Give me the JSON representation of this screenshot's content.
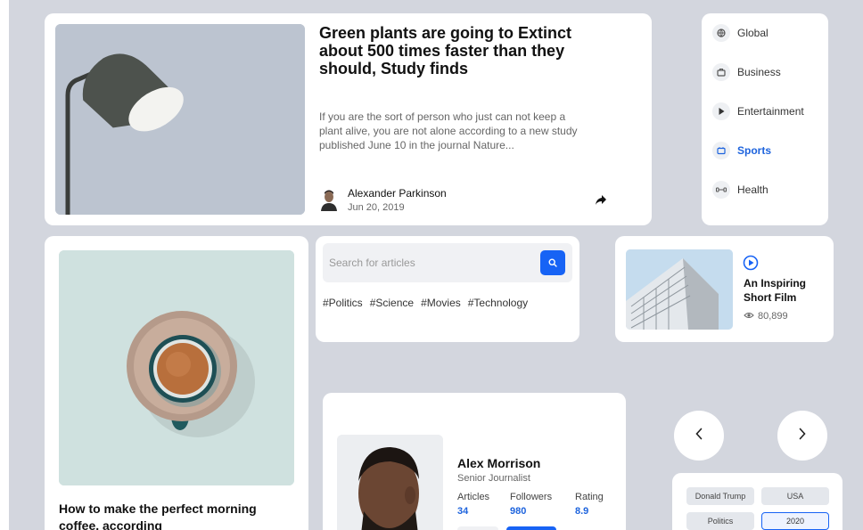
{
  "hero": {
    "title": "Green plants are going to Extinct about 500 times faster than they should, Study finds",
    "excerpt": "If you are the sort of person who just can not keep a plant alive, you are not alone according to a new study published June 10 in the journal Nature...",
    "author": "Alexander Parkinson",
    "date": "Jun 20, 2019"
  },
  "categories": [
    {
      "label": "Global",
      "icon": "globe-icon"
    },
    {
      "label": "Business",
      "icon": "briefcase-icon"
    },
    {
      "label": "Entertainment",
      "icon": "play-icon"
    },
    {
      "label": "Sports",
      "icon": "ticket-icon"
    },
    {
      "label": "Health",
      "icon": "dumbbell-icon"
    }
  ],
  "active_category": "Sports",
  "coffee": {
    "title": "How to make the perfect morning coffee, according"
  },
  "search": {
    "placeholder": "Search for articles",
    "tags": [
      "#Politics",
      "#Science",
      "#Movies",
      "#Technology"
    ]
  },
  "video": {
    "title": "An Inspiring Short Film",
    "views": "80,899"
  },
  "profile": {
    "name": "Alex Morrison",
    "role": "Senior Journalist",
    "stats": [
      {
        "label": "Articles",
        "value": "34"
      },
      {
        "label": "Followers",
        "value": "980"
      },
      {
        "label": "Rating",
        "value": "8.9"
      }
    ]
  },
  "chips": [
    "Donald Trump",
    "USA",
    "Politics",
    "2020"
  ],
  "active_chip": "2020",
  "colors": {
    "accent": "#1763f5",
    "background": "#d3d6de",
    "card": "#ffffff"
  }
}
